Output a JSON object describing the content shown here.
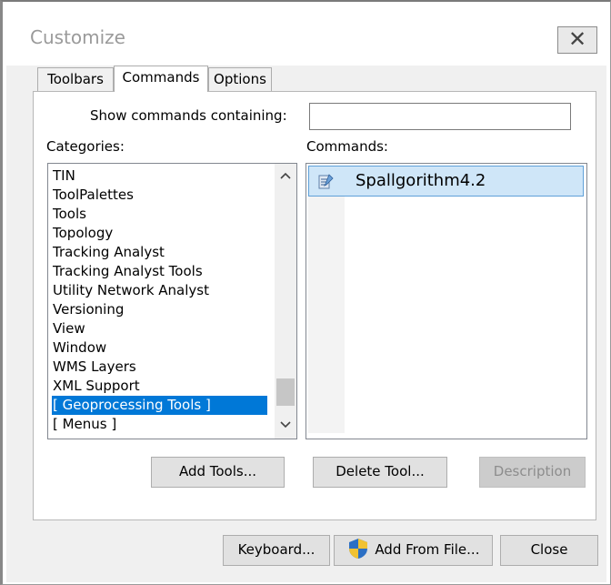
{
  "window": {
    "title": "Customize",
    "close_glyph": "✕"
  },
  "tabs": [
    {
      "label": "Toolbars"
    },
    {
      "label": "Commands",
      "active": true
    },
    {
      "label": "Options"
    }
  ],
  "search": {
    "label": "Show commands containing:",
    "value": ""
  },
  "categories": {
    "label": "Categories:",
    "items": [
      "TIN",
      "ToolPalettes",
      "Tools",
      "Topology",
      "Tracking Analyst",
      "Tracking Analyst Tools",
      "Utility Network Analyst",
      "Versioning",
      "View",
      "Window",
      "WMS Layers",
      "XML Support",
      "[ Geoprocessing Tools ]",
      "[ Menus ]"
    ],
    "selected": "[ Geoprocessing Tools ]"
  },
  "commands": {
    "label": "Commands:",
    "items": [
      {
        "label": "Spallgorithm4.2",
        "icon": "script-tool-icon",
        "selected": true
      }
    ]
  },
  "buttons": {
    "add_tools": "Add Tools...",
    "delete_tool": "Delete Tool...",
    "description": "Description",
    "keyboard": "Keyboard...",
    "add_from_file": "Add From File...",
    "close": "Close"
  },
  "colors": {
    "selection": "#0078d7",
    "command_selection": "#cfe6f8",
    "dialog_bg": "#f0f0f0"
  }
}
